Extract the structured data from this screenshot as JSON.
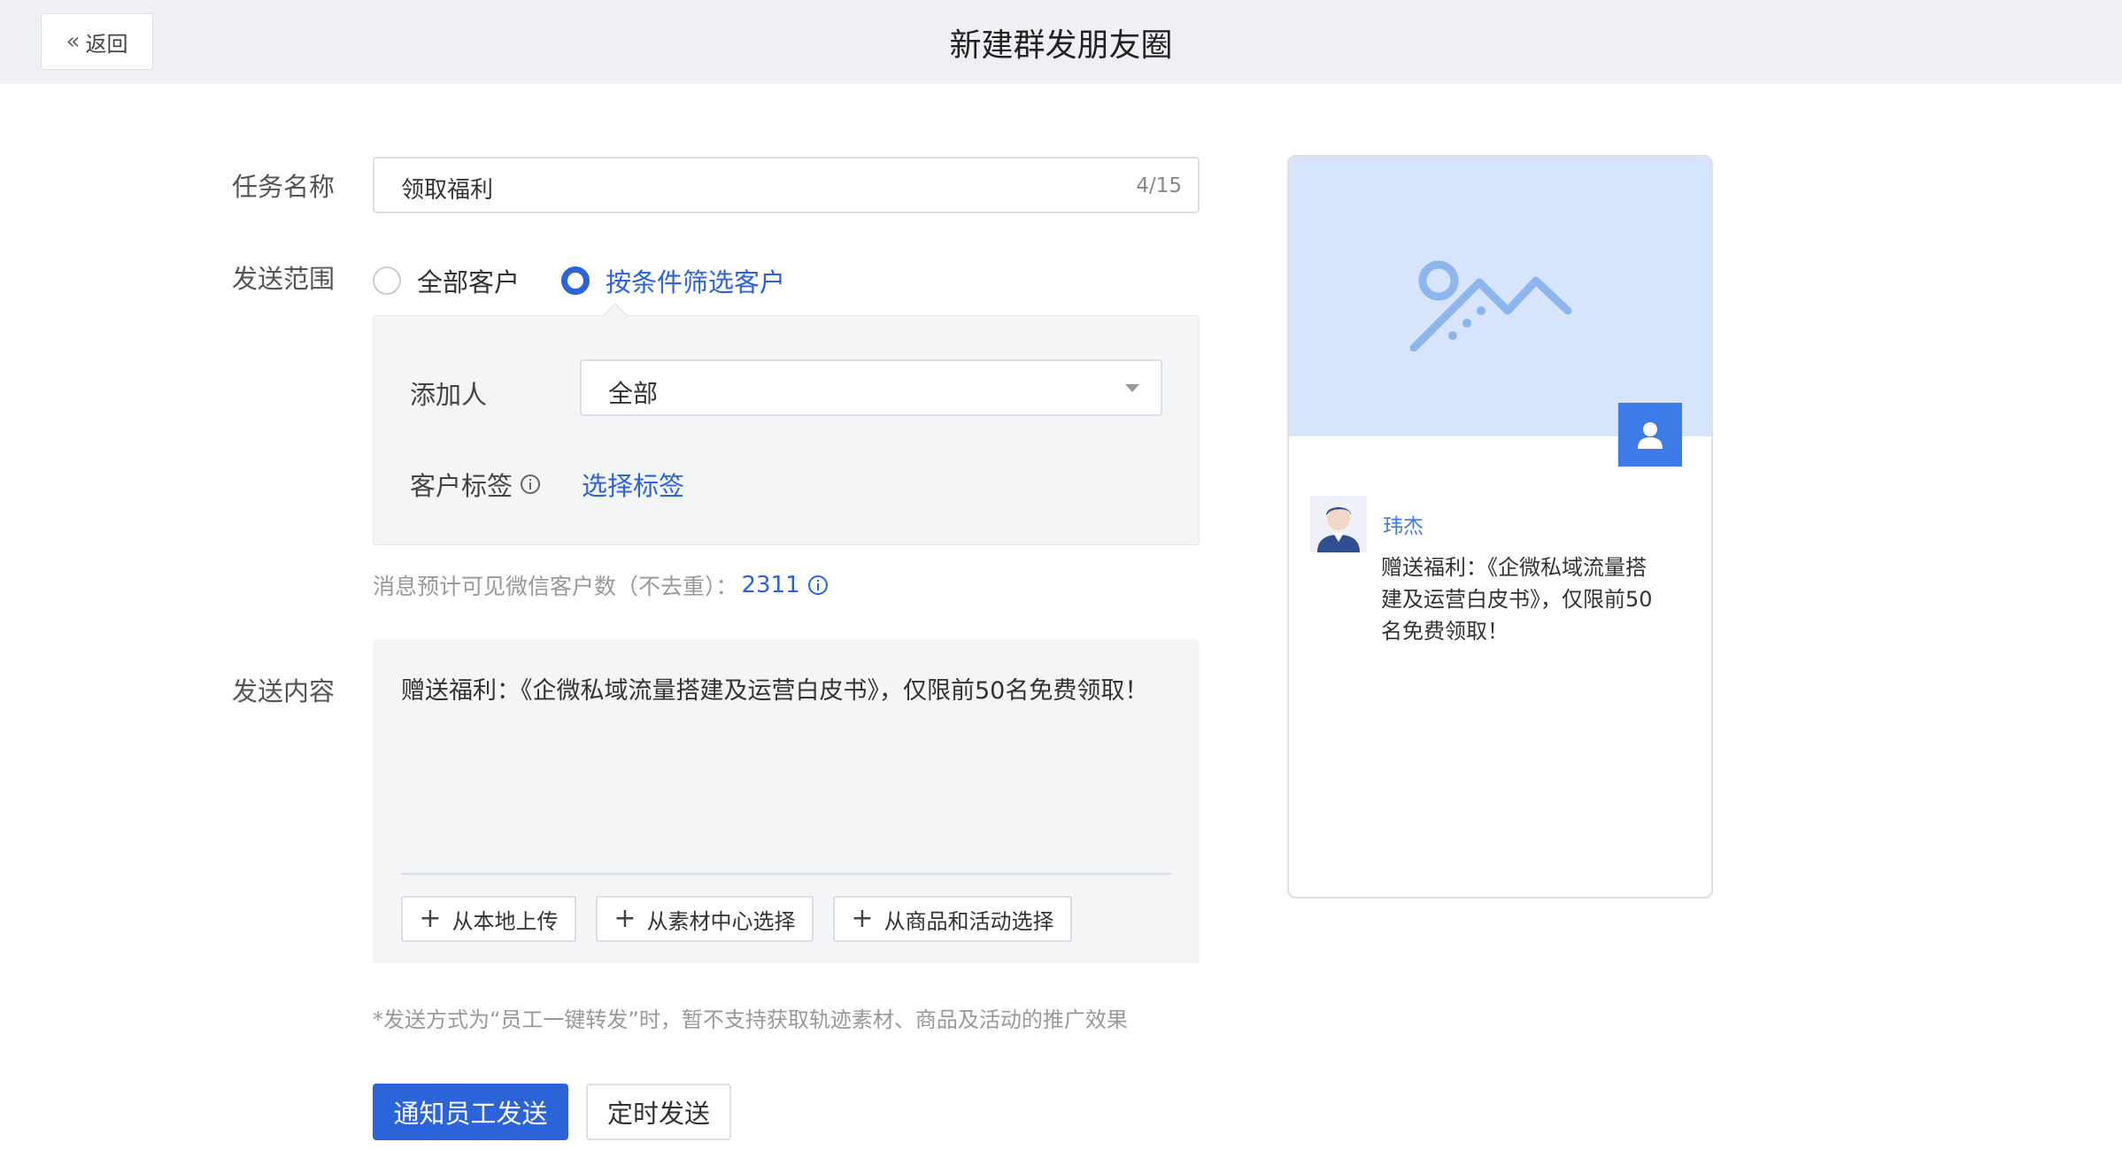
{
  "header": {
    "back_label": "返回",
    "title": "新建群发朋友圈"
  },
  "form": {
    "task_name": {
      "label": "任务名称",
      "value": "领取福利",
      "counter": "4/15"
    },
    "scope": {
      "label": "发送范围",
      "options": [
        "全部客户",
        "按条件筛选客户"
      ],
      "selected": "按条件筛选客户"
    },
    "filter": {
      "adder_label": "添加人",
      "adder_value": "全部",
      "tag_label": "客户标签",
      "tag_link": "选择标签"
    },
    "estimate": {
      "text": "消息预计可见微信客户数（不去重）：",
      "count": "2311"
    },
    "content": {
      "label": "发送内容",
      "text": "赠送福利：《企微私域流量搭建及运营白皮书》，仅限前50名免费领取！",
      "buttons": [
        "从本地上传",
        "从素材中心选择",
        "从商品和活动选择"
      ]
    },
    "note": "*发送方式为“员工一键转发”时，暂不支持获取轨迹素材、商品及活动的推广效果"
  },
  "actions": {
    "primary": "通知员工发送",
    "secondary": "定时发送"
  },
  "preview": {
    "user_name": "玮杰",
    "text": "赠送福利：《企微私域流量搭建及运营白皮书》，仅限前50名免费领取！"
  },
  "colors": {
    "accent": "#2b63d9",
    "cover": "#d6e5fb",
    "header_bg": "#eef0f3"
  }
}
